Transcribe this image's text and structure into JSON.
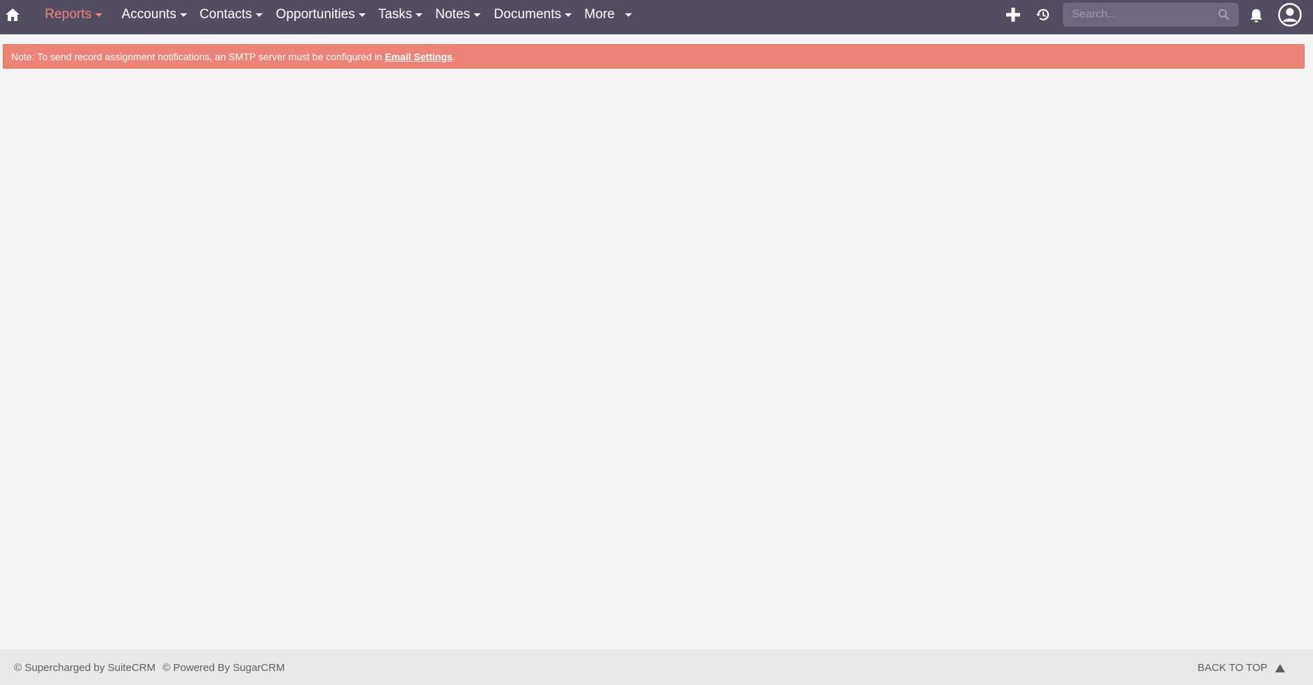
{
  "colors": {
    "navbar_bg": "#534d64",
    "active_nav": "#f08377",
    "alert_bg": "#ed8276",
    "page_bg": "#f4f4f4",
    "footer_bg": "#e8e8e8"
  },
  "navbar": {
    "home_icon": "home-icon",
    "menu": [
      {
        "label": "Reports",
        "active": true
      },
      {
        "label": "Accounts",
        "active": false
      },
      {
        "label": "Contacts",
        "active": false
      },
      {
        "label": "Opportunities",
        "active": false
      },
      {
        "label": "Tasks",
        "active": false
      },
      {
        "label": "Notes",
        "active": false
      },
      {
        "label": "Documents",
        "active": false
      },
      {
        "label": "More",
        "active": false
      }
    ],
    "create_icon": "plus-icon",
    "recent_icon": "history-icon",
    "search": {
      "placeholder": "Search...",
      "value": ""
    },
    "notifications_icon": "bell-icon",
    "profile_icon": "user-circle-icon"
  },
  "alert": {
    "prefix": "Note: To send record assignment notifications, an SMTP server must be configured in ",
    "link_text": "Email Settings",
    "suffix": "."
  },
  "footer": {
    "supercharged": "© Supercharged by SuiteCRM",
    "powered": "© Powered By SugarCRM",
    "back_to_top": "BACK TO TOP"
  }
}
